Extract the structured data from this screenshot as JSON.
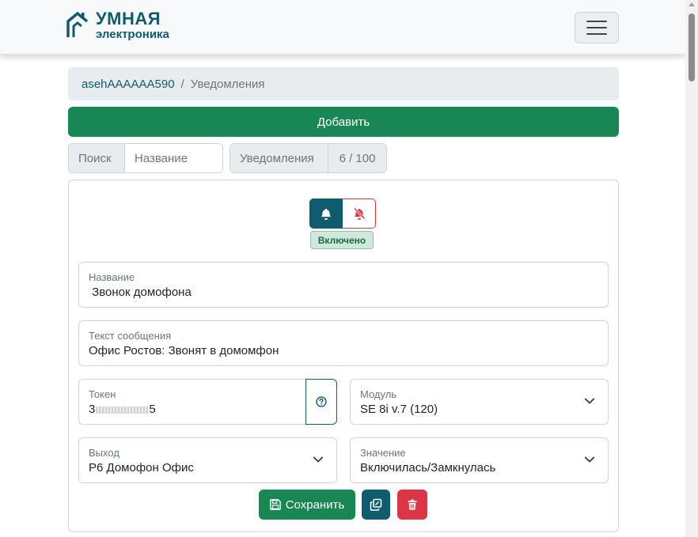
{
  "brand": {
    "line1": "УМНАЯ",
    "line2": "электроника",
    "color": "#0f5c6e"
  },
  "breadcrumb": {
    "user": "asehAAAAAA590",
    "separator": "/",
    "current": "Уведомления"
  },
  "actions": {
    "add_label": "Добавить"
  },
  "search": {
    "addon_label": "Поиск",
    "placeholder": "Название"
  },
  "counter": {
    "label": "Уведомления",
    "value": "6 / 100"
  },
  "notification": {
    "status_badge": "Включено",
    "enabled": true,
    "name": {
      "label": "Название",
      "value": " Звонок домофона"
    },
    "message": {
      "label": "Текст сообщения",
      "value": "Офис Ростов: Звонят в домомфон"
    },
    "token": {
      "label": "Токен",
      "value_start": "3",
      "value_end": "5"
    },
    "module": {
      "label": "Модуль",
      "value": "SE 8i v.7 (120)"
    },
    "output": {
      "label": "Выход",
      "value": "Р6 Домофон Офис"
    },
    "state": {
      "label": "Значение",
      "value": "Включилась/Замкнулась"
    },
    "save_label": "Сохранить"
  },
  "colors": {
    "primary": "#0f5c6e",
    "success": "#198754",
    "danger": "#dc3545"
  },
  "icons": [
    "house-logo-icon",
    "menu-icon",
    "bell-icon",
    "bell-slash-icon",
    "question-circle-icon",
    "chevron-down-icon",
    "save-icon",
    "copy-icon",
    "trash-icon"
  ]
}
